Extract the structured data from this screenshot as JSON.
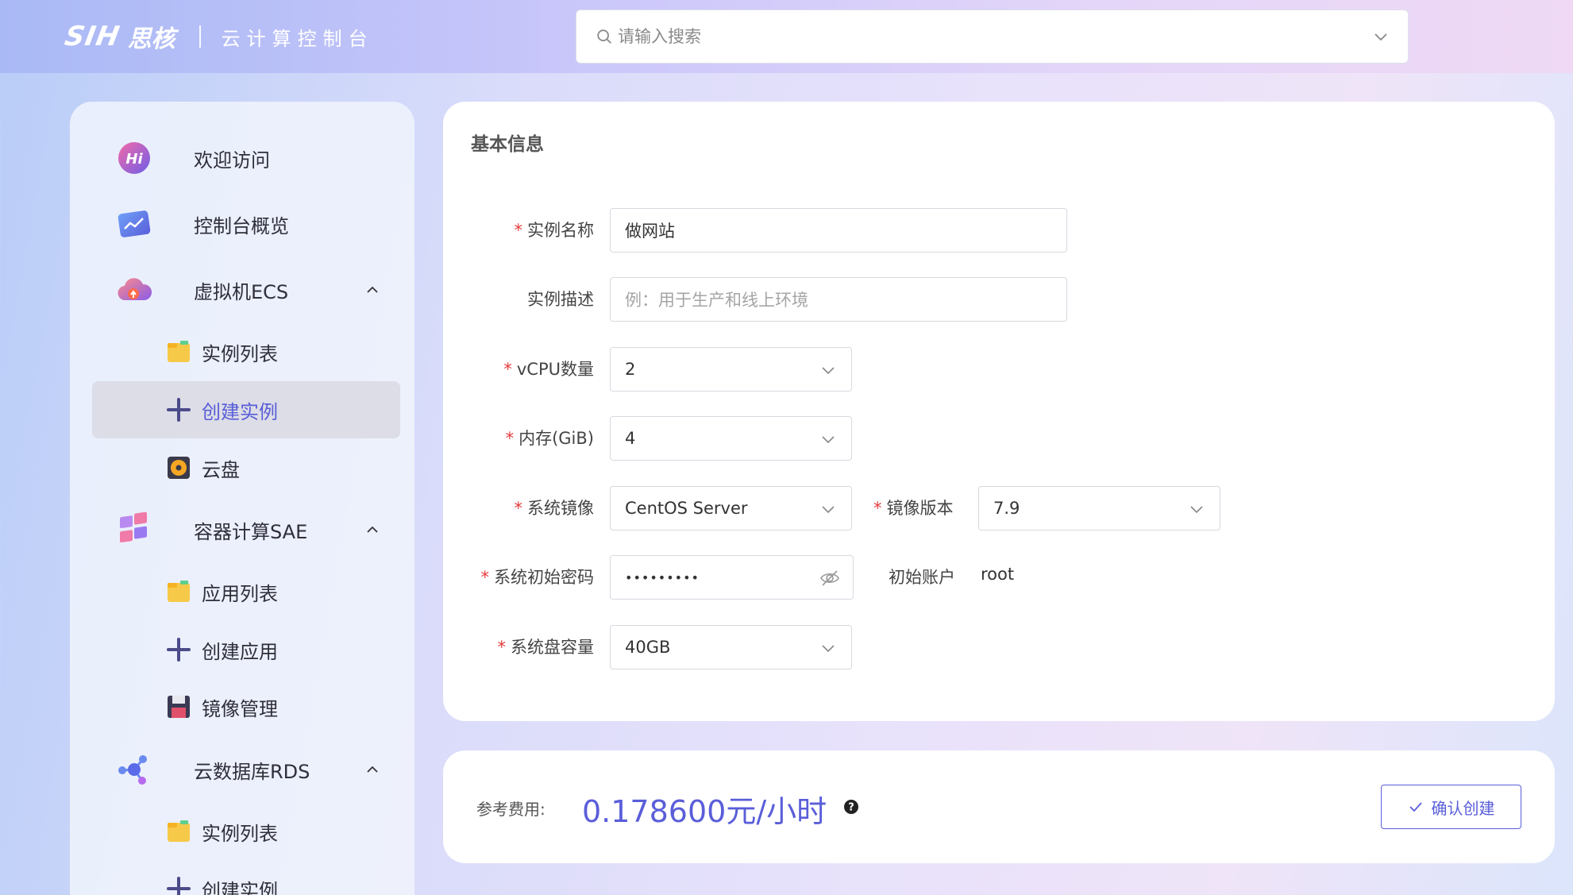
{
  "header": {
    "logo_mark": "SIH",
    "logo_cn": "思核",
    "logo_sub": "云计算控制台",
    "search_placeholder": "请输入搜索"
  },
  "sidebar": {
    "items": [
      {
        "label": "欢迎访问",
        "icon": "hi-icon"
      },
      {
        "label": "控制台概览",
        "icon": "dashboard-icon"
      },
      {
        "label": "虚拟机ECS",
        "icon": "cloud-upload-icon",
        "expanded": true,
        "children": [
          {
            "label": "实例列表",
            "icon": "folder-icon"
          },
          {
            "label": "创建实例",
            "icon": "plus-icon",
            "active": true
          },
          {
            "label": "云盘",
            "icon": "disk-icon"
          }
        ]
      },
      {
        "label": "容器计算SAE",
        "icon": "cubes-icon",
        "expanded": true,
        "children": [
          {
            "label": "应用列表",
            "icon": "folder-icon"
          },
          {
            "label": "创建应用",
            "icon": "plus-icon"
          },
          {
            "label": "镜像管理",
            "icon": "floppy-icon"
          }
        ]
      },
      {
        "label": "云数据库RDS",
        "icon": "database-network-icon",
        "expanded": true,
        "children": [
          {
            "label": "实例列表",
            "icon": "folder-icon"
          },
          {
            "label": "创建实例",
            "icon": "plus-icon"
          }
        ]
      }
    ]
  },
  "form": {
    "title": "基本信息",
    "instance_name": {
      "label": "实例名称",
      "required": true,
      "value": "做网站"
    },
    "instance_desc": {
      "label": "实例描述",
      "required": false,
      "placeholder": "例：用于生产和线上环境"
    },
    "vcpu": {
      "label": "vCPU数量",
      "required": true,
      "value": "2"
    },
    "memory": {
      "label": "内存(GiB)",
      "required": true,
      "value": "4"
    },
    "os_image": {
      "label": "系统镜像",
      "required": true,
      "value": "CentOS Server"
    },
    "image_version": {
      "label": "镜像版本",
      "required": true,
      "value": "7.9"
    },
    "password": {
      "label": "系统初始密码",
      "required": true,
      "value": "•••••••••"
    },
    "init_account": {
      "label": "初始账户",
      "value": "root"
    },
    "disk": {
      "label": "系统盘容量",
      "required": true,
      "value": "40GB"
    }
  },
  "fee": {
    "label": "参考费用:",
    "value": "0.178600元/小时",
    "confirm_label": "确认创建"
  },
  "colors": {
    "accent": "#5a5ed9",
    "required": "#e23b3b"
  }
}
